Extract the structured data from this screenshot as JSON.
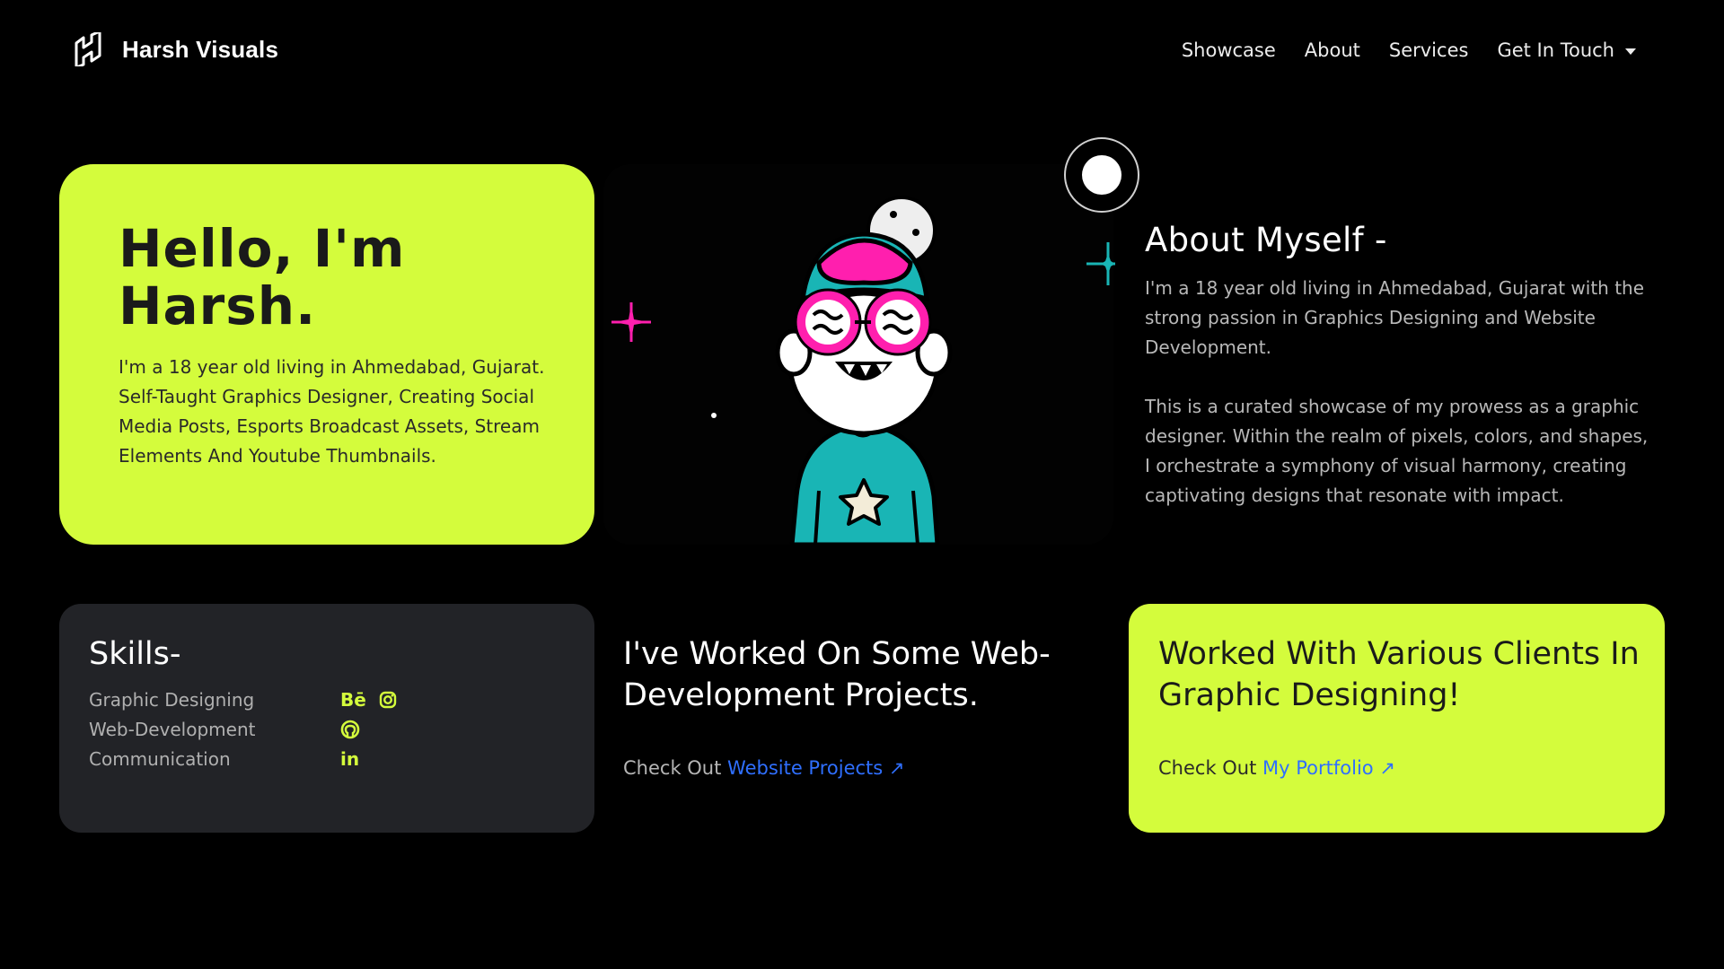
{
  "nav": {
    "brand": "Harsh Visuals",
    "links": [
      "Showcase",
      "About",
      "Services"
    ],
    "dropdown_label": "Get In Touch"
  },
  "hero": {
    "title_line1": "Hello, I'm",
    "title_line2": "Harsh.",
    "description": "I'm a 18 year old living in Ahmedabad, Gujarat. Self-Taught Graphics Designer, Creating Social Media Posts, Esports Broadcast Assets, Stream Elements And Youtube Thumbnails."
  },
  "about": {
    "title": "About Myself -",
    "para1": "I'm a 18 year old living in Ahmedabad, Gujarat with the strong passion in Graphics Designing and Website Development.",
    "para2": "This is a curated showcase of my prowess as a graphic designer. Within the realm of pixels, colors, and shapes, I orchestrate a symphony of visual harmony, creating captivating designs that resonate with impact."
  },
  "skills": {
    "title": "Skills-",
    "items": [
      {
        "name": "Graphic Designing",
        "icons": [
          "Bē",
          "instagram-icon"
        ]
      },
      {
        "name": "Web-Development",
        "icons": [
          "github-icon"
        ]
      },
      {
        "name": "Communication",
        "icons": [
          "in"
        ]
      }
    ]
  },
  "webdev": {
    "title": "I've Worked On Some Web-Development Projects.",
    "check_prefix": "Check Out",
    "link": "Website Projects"
  },
  "clients": {
    "title": "Worked With Various Clients In Graphic Designing!",
    "check_prefix": "Check Out",
    "link": "My Portfolio"
  },
  "colors": {
    "accent": "#d4fc3c",
    "link": "#2f6fff",
    "card_dark": "#222327",
    "magenta": "#ff1fae",
    "teal": "#19b5b5"
  }
}
